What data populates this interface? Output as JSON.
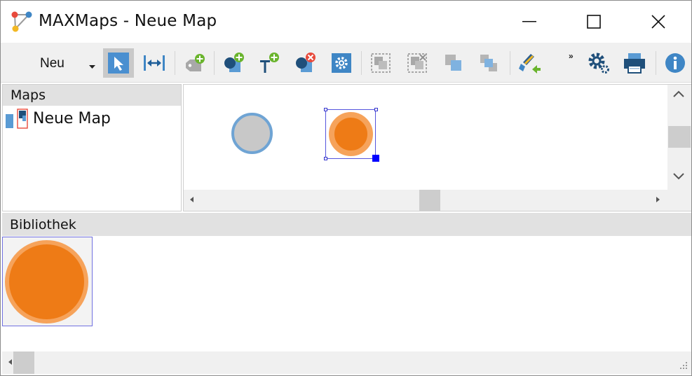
{
  "window": {
    "app_name": "MAXMaps",
    "title": "MAXMaps - Neue Map",
    "controls": [
      "minimize-icon",
      "maximize-icon",
      "close-icon"
    ]
  },
  "toolbar": {
    "new_label": "Neu",
    "overflow_label": "»",
    "buttons": [
      "pointer-icon",
      "connector-icon",
      "add-tag-icon",
      "add-node-icon",
      "add-text-icon",
      "delete-node-icon",
      "node-settings-icon",
      "group-icon",
      "ungroup-icon",
      "bring-front-icon",
      "send-back-icon",
      "format-painter-icon",
      "settings-icon",
      "print-icon",
      "info-icon"
    ],
    "active_button": "pointer-icon"
  },
  "maps_panel": {
    "header": "Maps",
    "items": [
      {
        "label": "Neue Map",
        "icon": "map-document-icon"
      }
    ]
  },
  "canvas": {
    "nodes": [
      {
        "shape": "circle",
        "fill": "#c8c8c8",
        "border": "#6fa4d4",
        "selected": false
      },
      {
        "shape": "circle",
        "fill": "#ee7b16",
        "border": "#f6a35b",
        "selected": true
      }
    ]
  },
  "library_panel": {
    "header": "Bibliothek",
    "items": [
      {
        "shape": "circle",
        "fill": "#ee7b16",
        "border": "#f6a35b"
      }
    ]
  },
  "colors": {
    "accent_blue": "#3f86c5",
    "accent_green": "#6ab42d",
    "accent_red": "#e84a3c",
    "orange": "#ee7b16",
    "orange_light": "#f6a35b"
  }
}
